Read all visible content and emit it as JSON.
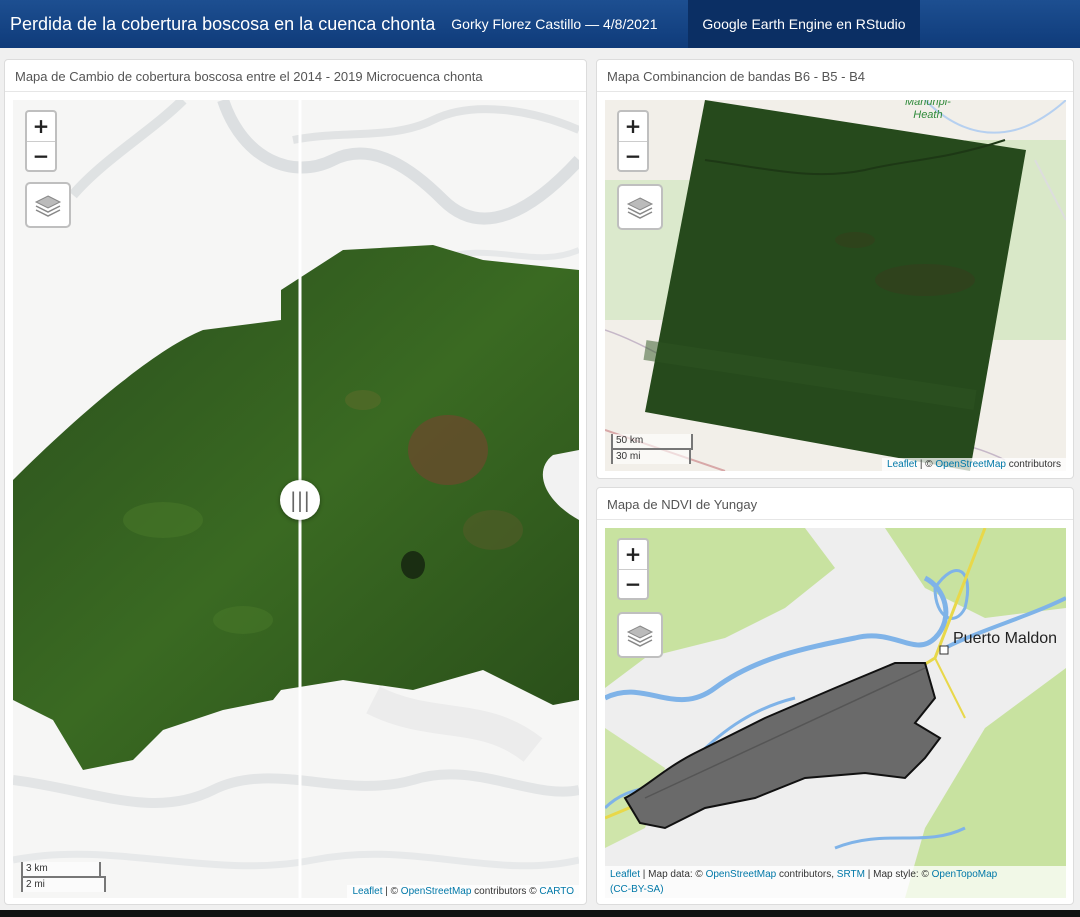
{
  "navbar": {
    "title": "Perdida de la cobertura boscosa en la cuenca chonta",
    "author": "Gorky Florez Castillo — 4/8/2021",
    "tab_label": "Google Earth Engine en RStudio"
  },
  "panel_left": {
    "title": "Mapa de Cambio de cobertura boscosa entre el 2014 - 2019 Microcuenca chonta",
    "zoom_in": "+",
    "zoom_out": "−",
    "layers_icon": "layers-icon",
    "scale_km": "3 km",
    "scale_mi": "2 mi",
    "slider_handle": "|||",
    "attribution": {
      "leaflet": "Leaflet",
      "sep": " | © ",
      "osm": "OpenStreetMap",
      "contrib": " contributors © ",
      "carto": "CARTO"
    }
  },
  "panel_top_right": {
    "title": "Mapa Combinancion de bandas B6 - B5 - B4",
    "zoom_in": "+",
    "zoom_out": "−",
    "scale_km": "50 km",
    "scale_mi": "30 mi",
    "place_label": "Manuripi-\nHeath",
    "attribution": {
      "leaflet": "Leaflet",
      "sep": " | © ",
      "osm": "OpenStreetMap",
      "contrib": " contributors"
    }
  },
  "panel_bottom_right": {
    "title": "Mapa de NDVI de Yungay",
    "zoom_in": "+",
    "zoom_out": "−",
    "place_label": "Puerto Maldon",
    "attribution": {
      "leaflet": "Leaflet",
      "p1": " | Map data: © ",
      "osm": "OpenStreetMap",
      "p2": " contributors, ",
      "srtm": "SRTM",
      "p3": " | Map style: © ",
      "otm": "OpenTopoMap",
      "cc": "(CC-BY-SA)"
    }
  },
  "colors": {
    "navbar": "#0f3b7a",
    "forest": "#2e5a1c",
    "river": "#8fb7e0",
    "link": "#0078a8"
  }
}
